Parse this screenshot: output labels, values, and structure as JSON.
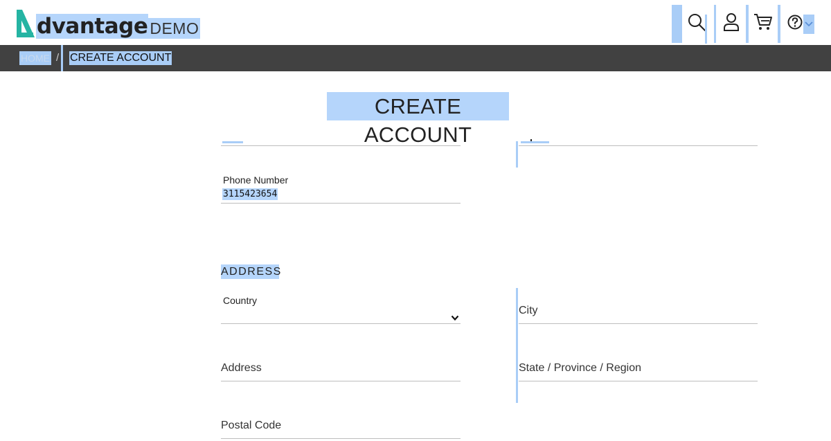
{
  "header": {
    "logo_word": "dvantage",
    "logo_demo": "DEMO",
    "icons": {
      "search": "search-icon",
      "user": "user-icon",
      "cart": "cart-icon",
      "help": "help-icon",
      "menu": "chevron-down-icon"
    },
    "colors": {
      "accent": "#25b4a3",
      "selection": "#b5d5fb",
      "breadcrumb_bg": "#414141"
    }
  },
  "breadcrumb": {
    "home": "HOME",
    "separator": "/",
    "current": "CREATE ACCOUNT"
  },
  "page": {
    "title": "CREATE ACCOUNT"
  },
  "account_details": {
    "phone": {
      "label": "Phone Number",
      "value": "3115423654"
    }
  },
  "address": {
    "section_title": "ADDRESS",
    "country": {
      "label": "Country",
      "value": ""
    },
    "city": {
      "label": "City"
    },
    "address": {
      "label": "Address"
    },
    "state": {
      "label": "State / Province / Region"
    },
    "postal": {
      "label": "Postal Code"
    }
  }
}
